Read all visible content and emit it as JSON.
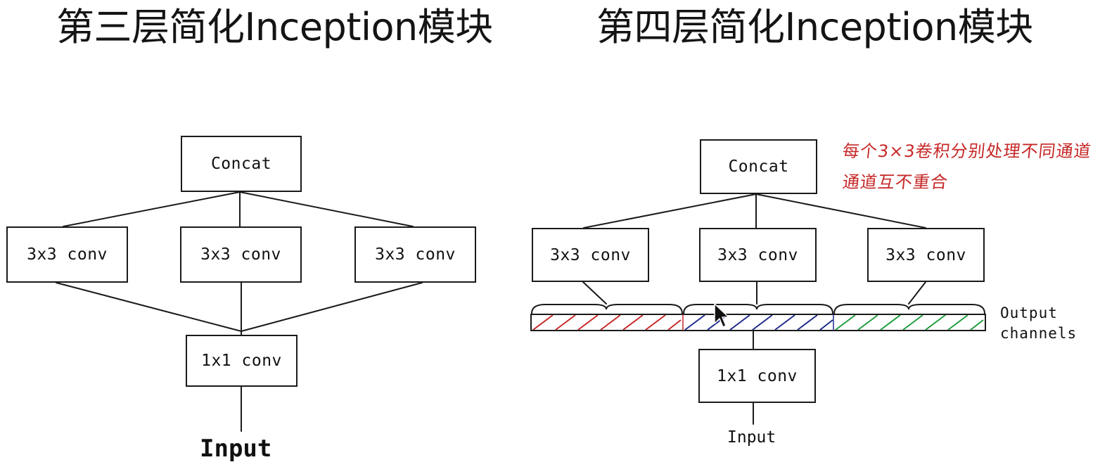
{
  "left": {
    "title": "第三层简化Inception模块",
    "concat_label": "Concat",
    "conv_labels": [
      "3x3 conv",
      "3x3 conv",
      "3x3 conv"
    ],
    "pointwise_label": "1x1 conv",
    "input_label": "Input"
  },
  "right": {
    "title": "第四层简化Inception模块",
    "concat_label": "Concat",
    "conv_labels": [
      "3x3 conv",
      "3x3 conv",
      "3x3 conv"
    ],
    "pointwise_label": "1x1 conv",
    "input_label": "Input",
    "output_label_line1": "Output",
    "output_label_line2": "channels",
    "note_line1": "每个3×3卷积分别处理不同通道",
    "note_line2": "通道互不重合",
    "channel_group_colors": [
      "#c62828",
      "#1f2a8a",
      "#1e9c3e"
    ],
    "note_color": "#c62828"
  },
  "icons": {
    "cursor": "mouse-pointer-icon"
  }
}
